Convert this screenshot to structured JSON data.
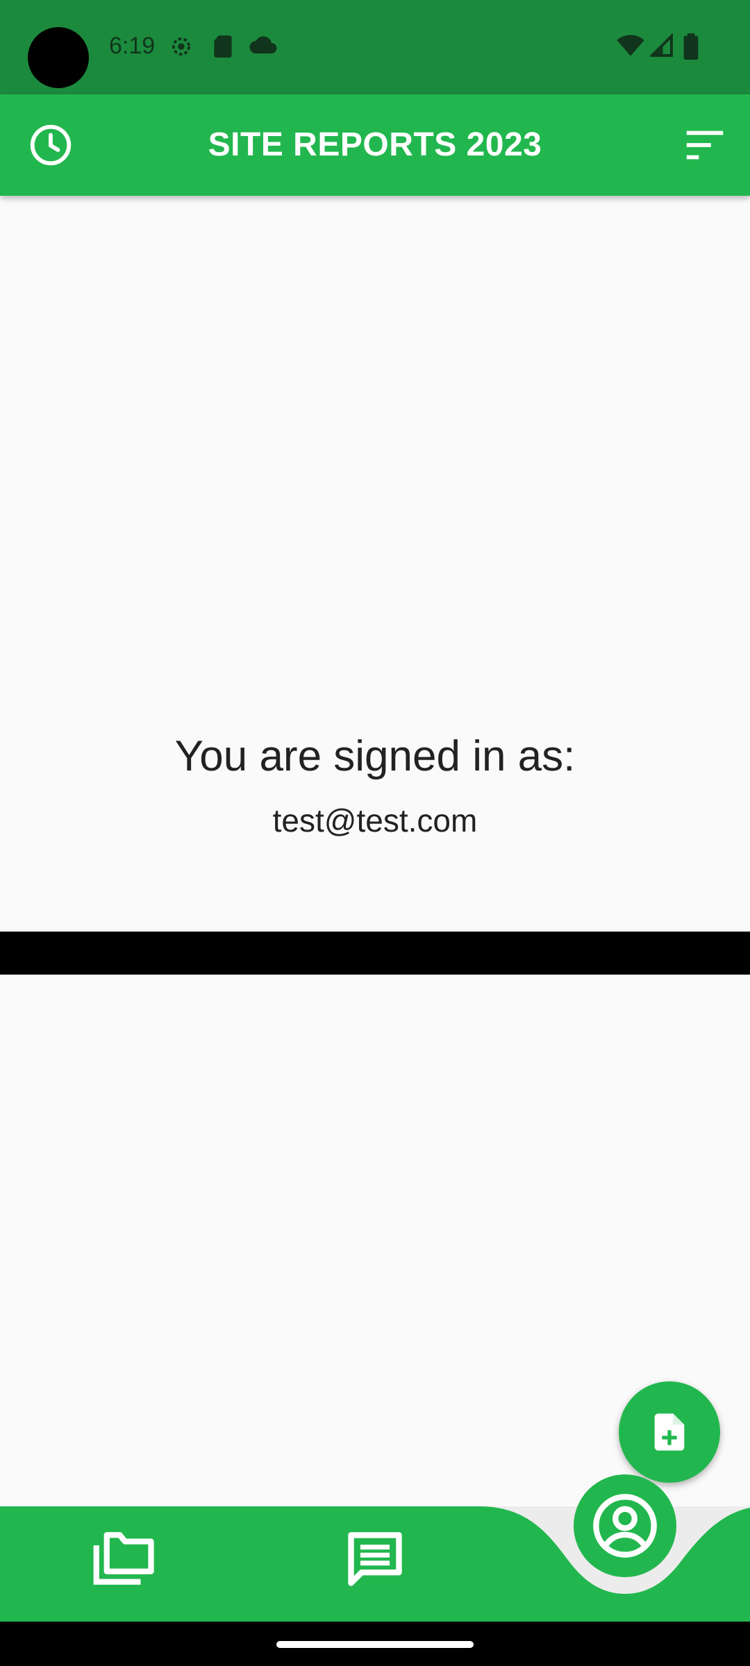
{
  "status_bar": {
    "time": "6:19",
    "icons": [
      "settings-gear-icon",
      "sd-card-icon",
      "cloud-icon",
      "wifi-icon",
      "signal-icon",
      "battery-icon"
    ]
  },
  "app_bar": {
    "title": "SITE REPORTS 2023",
    "left_icon": "history-clock-icon",
    "right_icon": "sort-filter-icon"
  },
  "main": {
    "signed_in_label": "You are signed in as:",
    "email": "test@test.com"
  },
  "fab": {
    "icon": "add-document-icon"
  },
  "bottom_nav": {
    "items": [
      {
        "icon": "folders-icon"
      },
      {
        "icon": "message-icon"
      },
      {
        "icon": "account-profile-icon"
      }
    ]
  },
  "colors": {
    "status_bar": "#1c8a3d",
    "accent_green": "#22b74e",
    "background": "#fafafa",
    "text": "#222222"
  }
}
